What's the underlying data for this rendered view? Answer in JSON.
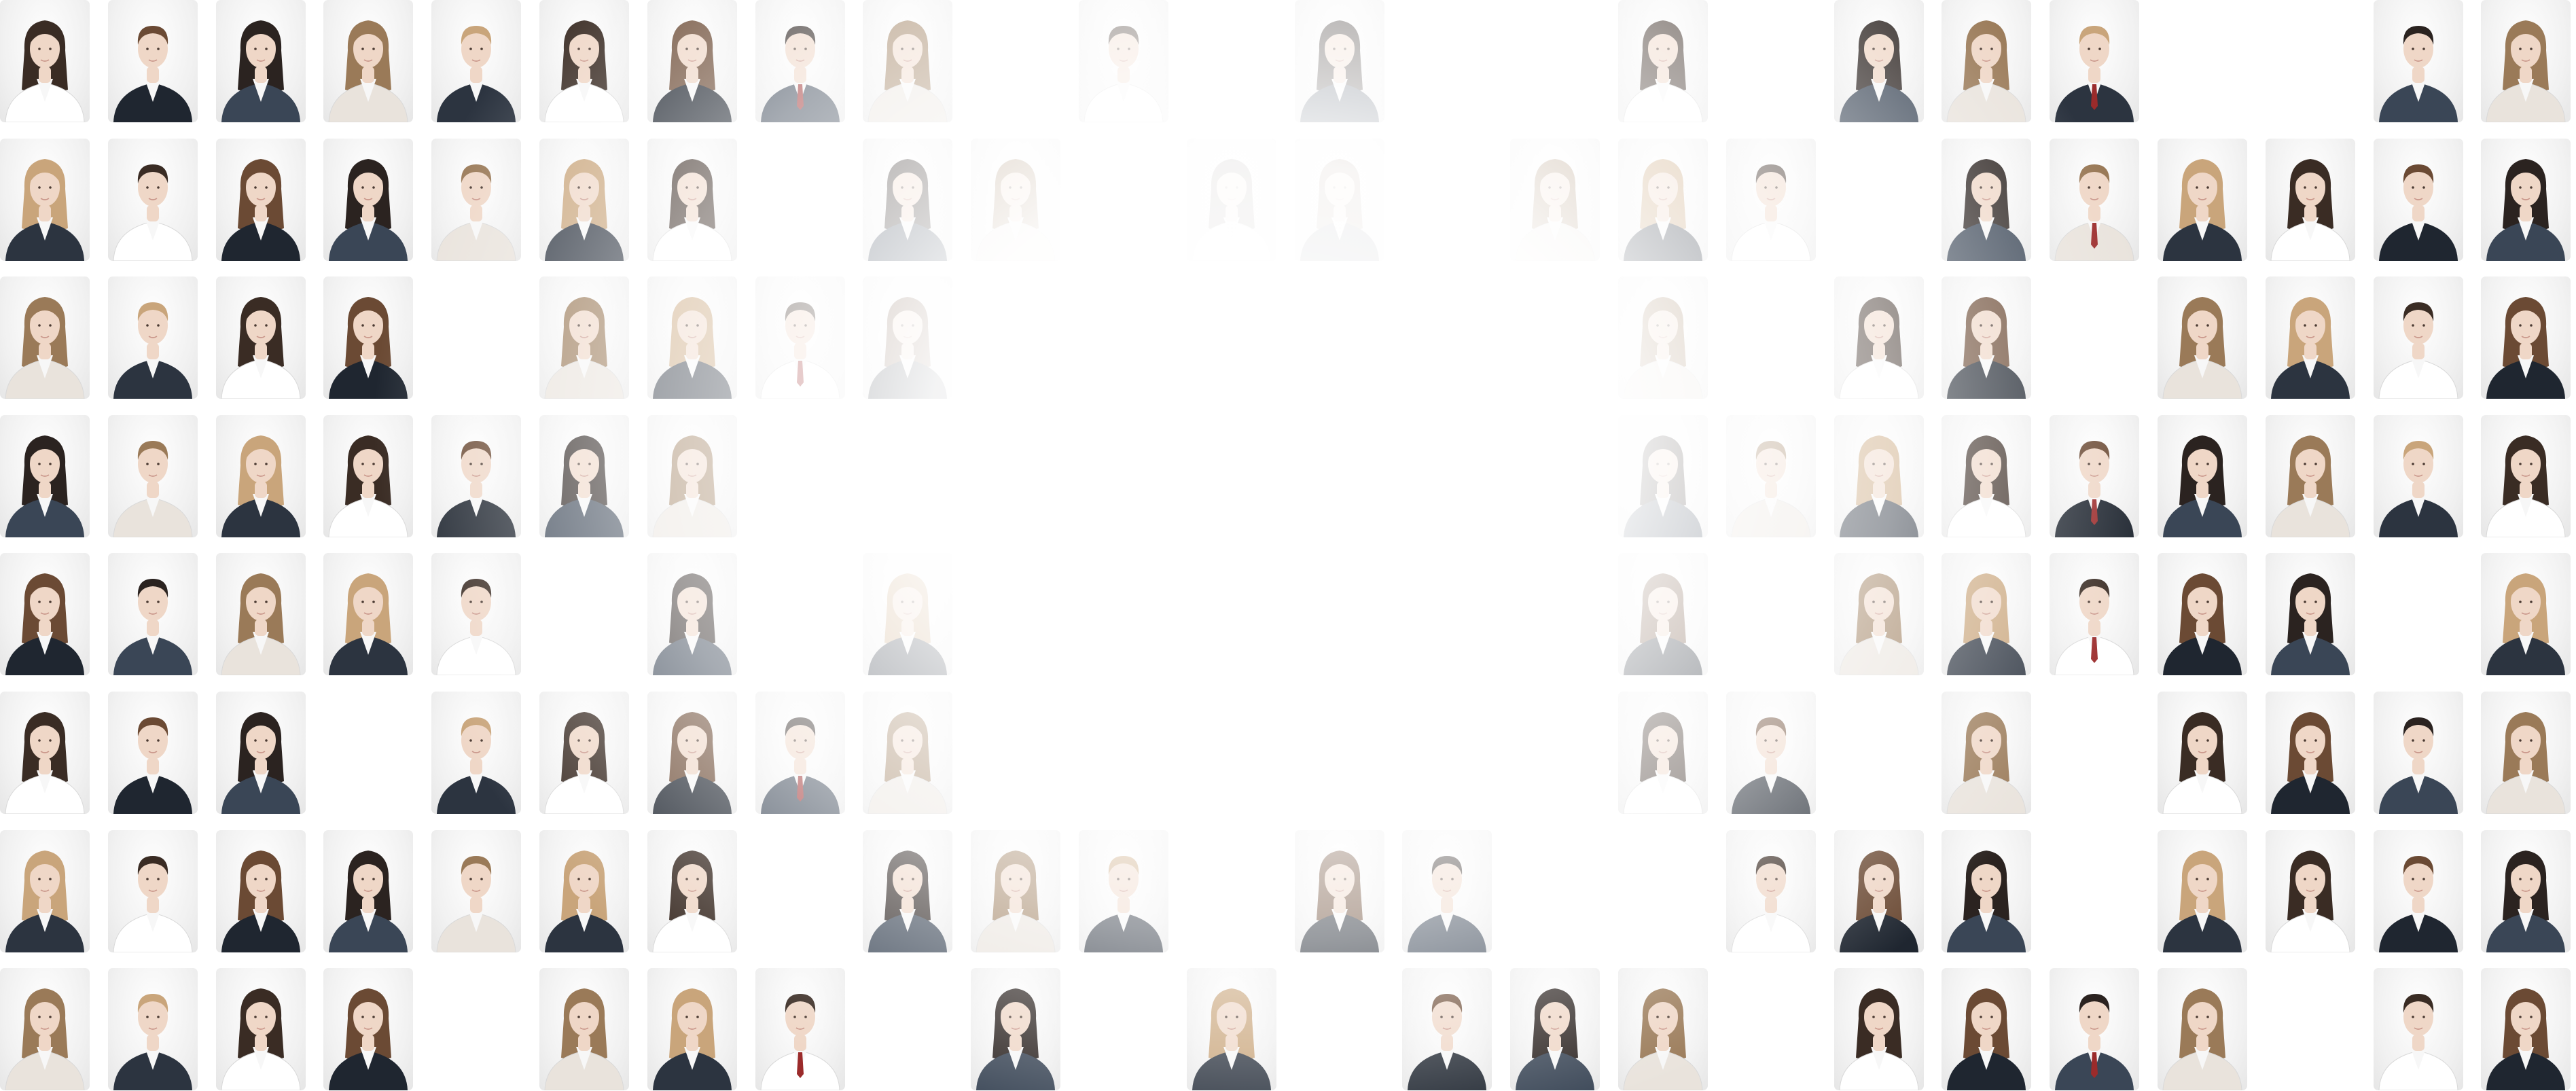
{
  "palette": {
    "background": "#ffffff",
    "tile_background": "#eeeeee",
    "skin": "#efd7c7",
    "hair": [
      "#3a2c24",
      "#6b4a34",
      "#2b2320",
      "#9a7a58",
      "#c9a57b"
    ],
    "suit": [
      "#1f2630",
      "#2c3440",
      "#3a4656",
      "#ffffff",
      "#e9e3dc"
    ],
    "accent_tie": "#9b2b2b"
  },
  "icon": "person-portrait-icon",
  "grid": {
    "columns": 24,
    "rows": 8,
    "tiles": [
      [
        1,
        1,
        1,
        1,
        1,
        1,
        1,
        1,
        1,
        0,
        1,
        0,
        1,
        0,
        0,
        1,
        0,
        1,
        1,
        1,
        0,
        0,
        1,
        1
      ],
      [
        1,
        1,
        1,
        1,
        1,
        1,
        1,
        0,
        1,
        1,
        0,
        1,
        1,
        0,
        1,
        1,
        1,
        0,
        1,
        1,
        1,
        1,
        1,
        1
      ],
      [
        1,
        1,
        1,
        1,
        0,
        1,
        1,
        1,
        1,
        0,
        0,
        0,
        0,
        0,
        0,
        1,
        0,
        1,
        1,
        0,
        1,
        1,
        1,
        1
      ],
      [
        1,
        1,
        1,
        1,
        1,
        1,
        1,
        0,
        0,
        0,
        0,
        0,
        0,
        0,
        0,
        1,
        1,
        1,
        1,
        1,
        1,
        1,
        1,
        1
      ],
      [
        1,
        1,
        1,
        1,
        1,
        0,
        1,
        0,
        1,
        0,
        0,
        0,
        0,
        0,
        0,
        1,
        0,
        1,
        1,
        1,
        1,
        1,
        0,
        1
      ],
      [
        1,
        1,
        1,
        0,
        1,
        1,
        1,
        1,
        1,
        0,
        0,
        0,
        0,
        0,
        0,
        1,
        1,
        0,
        1,
        0,
        1,
        1,
        1,
        1
      ],
      [
        1,
        1,
        1,
        1,
        1,
        1,
        1,
        0,
        1,
        1,
        1,
        0,
        1,
        1,
        0,
        0,
        1,
        1,
        1,
        0,
        1,
        1,
        1,
        1
      ],
      [
        1,
        1,
        1,
        1,
        0,
        1,
        1,
        1,
        0,
        1,
        0,
        1,
        0,
        1,
        1,
        1,
        0,
        1,
        1,
        1,
        1,
        0,
        1,
        1
      ]
    ]
  }
}
